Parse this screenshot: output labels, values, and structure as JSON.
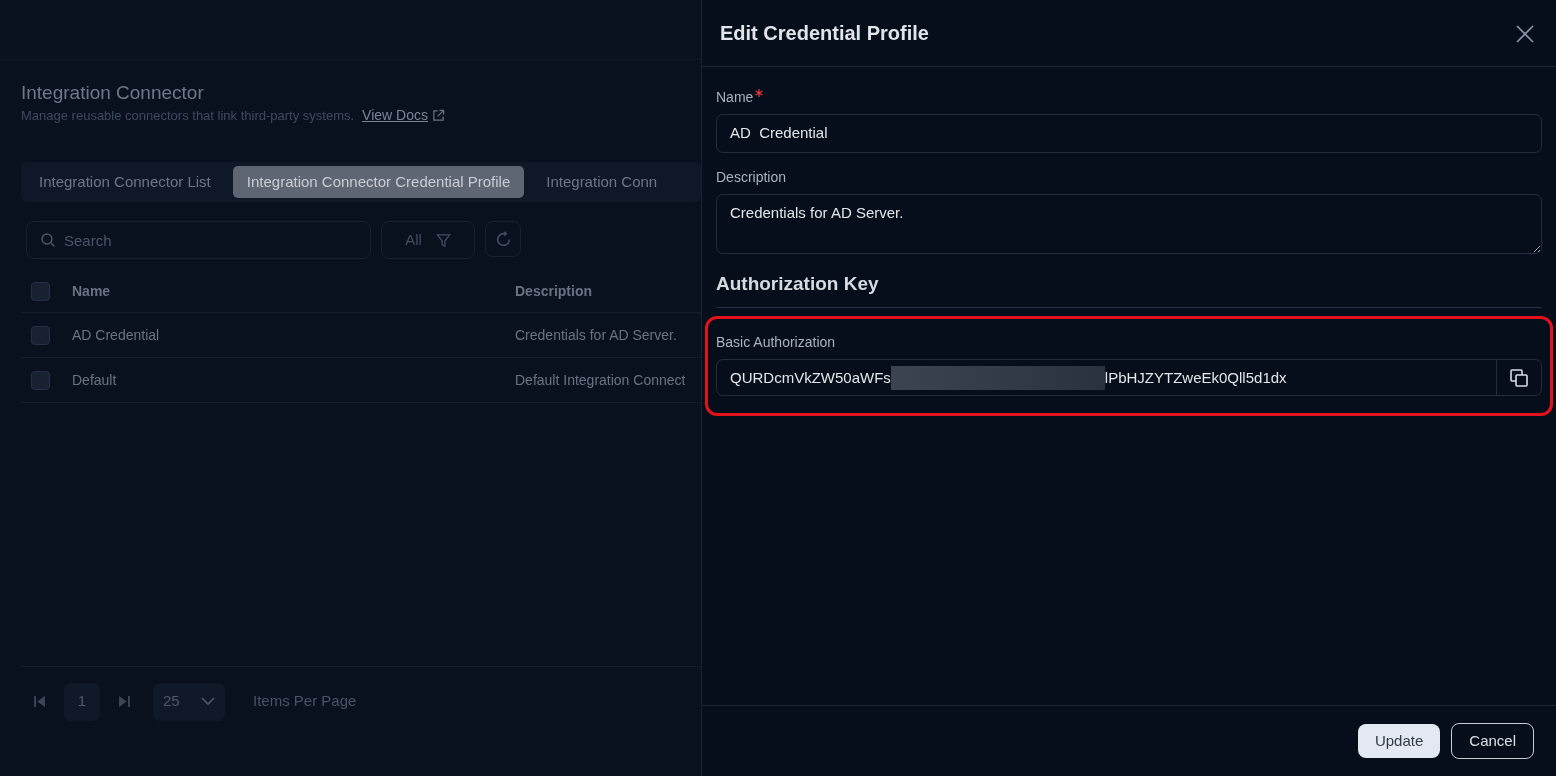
{
  "page": {
    "title": "Integration Connector",
    "subtitle": "Manage reusable connectors that link third-party systems.",
    "docs_link": "View Docs"
  },
  "tabs": [
    {
      "label": "Integration Connector List",
      "selected": false
    },
    {
      "label": "Integration Connector Credential Profile",
      "selected": true
    },
    {
      "label": "Integration Conn",
      "selected": false
    }
  ],
  "toolbar": {
    "search_placeholder": "Search",
    "filter": "All"
  },
  "table": {
    "columns": [
      "Name",
      "Description"
    ],
    "header_checked": false,
    "rows": [
      {
        "name": "AD Credential",
        "description": "Credentials for AD Server.",
        "checked": false
      },
      {
        "name": "Default",
        "description": "Default Integration Connect",
        "checked": false
      }
    ]
  },
  "pagination": {
    "page": "1",
    "page_size": "25",
    "page_size_label": "Items Per Page"
  },
  "drawer": {
    "title": "Edit Credential Profile",
    "fields": [
      {
        "label": "Name",
        "required": true,
        "value": "AD  Credential",
        "kind": "input"
      },
      {
        "label": "Description",
        "required": false,
        "value": "Credentials for AD Server.",
        "kind": "textarea"
      }
    ],
    "section": "Authorization Key",
    "auth": {
      "label": "Basic Authorization",
      "value_start": "QURDcmVkZW50aWFs",
      "value_end": "lPbHJZYTZweEk0Qll5d1dx",
      "redacted": true,
      "highlighted": true
    },
    "buttons": [
      {
        "label": "Update",
        "kind": "primary"
      },
      {
        "label": "Cancel",
        "kind": "secondary"
      }
    ]
  }
}
